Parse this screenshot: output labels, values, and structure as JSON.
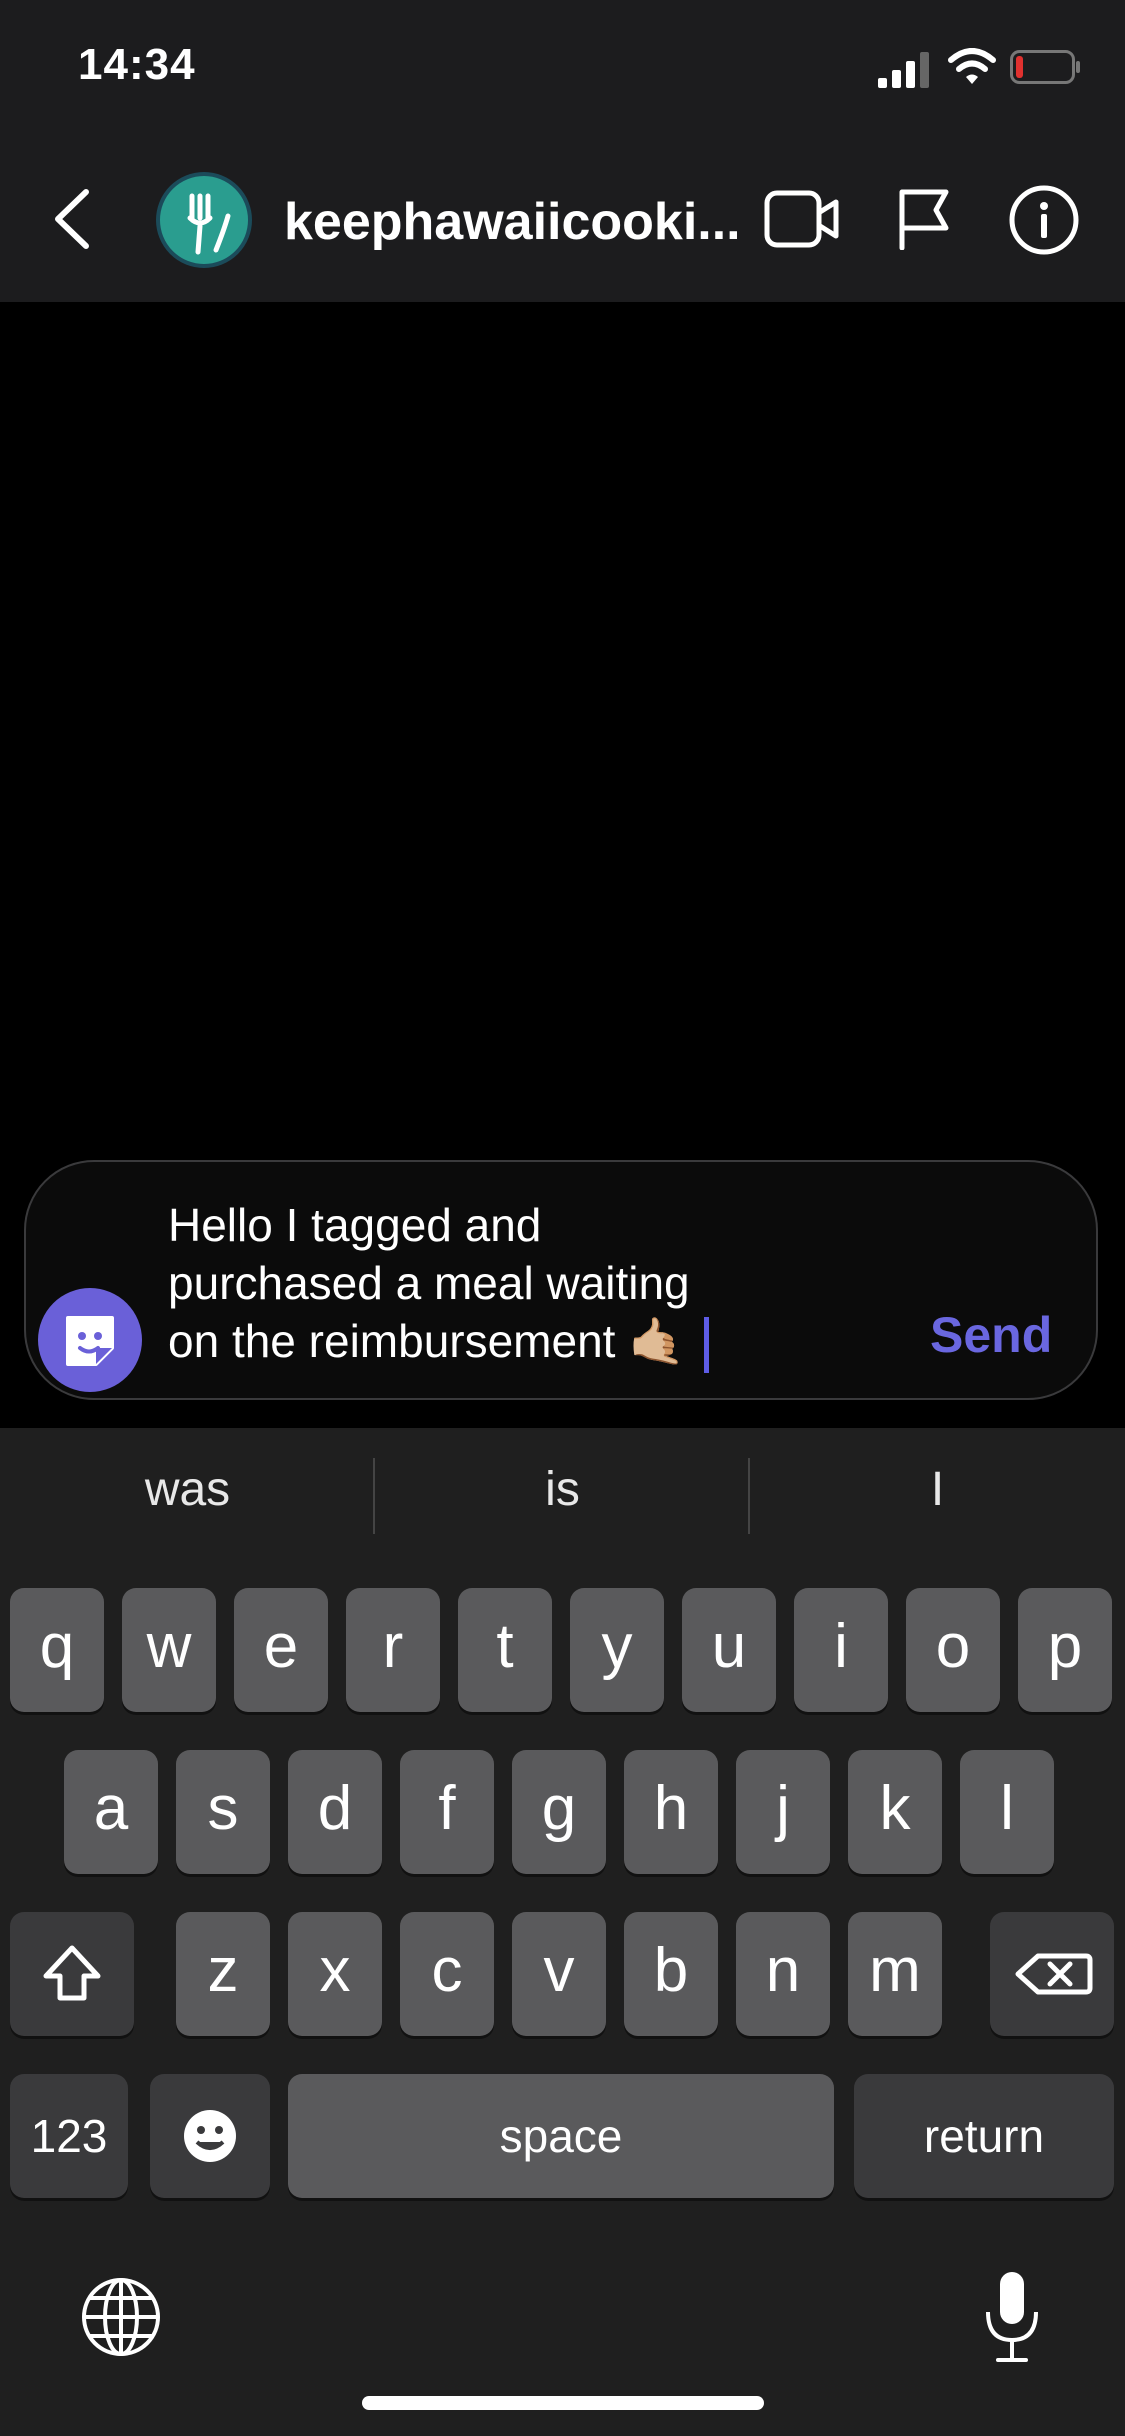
{
  "status_bar": {
    "time": "14:34"
  },
  "header": {
    "contact_name": "keephawaiicooki..."
  },
  "composer": {
    "text_lines": [
      "Hello I tagged and",
      "purchased a meal waiting",
      "on the reimbursement 🤙🏼"
    ],
    "send_label": "Send"
  },
  "keyboard": {
    "suggestions": [
      "was",
      "is",
      "I"
    ],
    "row1": [
      "q",
      "w",
      "e",
      "r",
      "t",
      "y",
      "u",
      "i",
      "o",
      "p"
    ],
    "row2": [
      "a",
      "s",
      "d",
      "f",
      "g",
      "h",
      "j",
      "k",
      "l"
    ],
    "row3": [
      "z",
      "x",
      "c",
      "v",
      "b",
      "n",
      "m"
    ],
    "numbers_label": "123",
    "space_label": "space",
    "return_label": "return"
  },
  "colors": {
    "accent": "#6a67e0",
    "background": "#000000",
    "keyboard": "#1f1f1f"
  }
}
